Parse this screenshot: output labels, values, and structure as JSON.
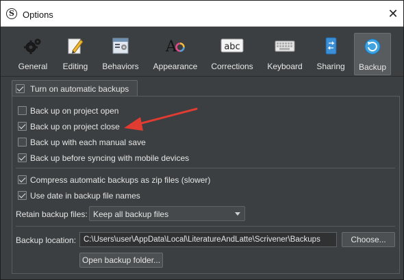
{
  "window": {
    "title": "Options"
  },
  "toolbar": {
    "items": [
      {
        "label": "General",
        "icon": "gears-icon"
      },
      {
        "label": "Editing",
        "icon": "pencil-icon"
      },
      {
        "label": "Behaviors",
        "icon": "behaviors-icon"
      },
      {
        "label": "Appearance",
        "icon": "font-color-icon"
      },
      {
        "label": "Corrections",
        "icon": "abc-icon"
      },
      {
        "label": "Keyboard",
        "icon": "keyboard-icon"
      },
      {
        "label": "Sharing",
        "icon": "sharing-icon"
      },
      {
        "label": "Backup",
        "icon": "backup-icon"
      }
    ],
    "active": "Backup"
  },
  "backup": {
    "master_toggle": {
      "label": "Turn on automatic backups",
      "checked": true
    },
    "options": [
      {
        "label": "Back up on project open",
        "checked": false
      },
      {
        "label": "Back up on project close",
        "checked": true
      },
      {
        "label": "Back up with each manual save",
        "checked": false
      },
      {
        "label": "Back up before syncing with mobile devices",
        "checked": true
      }
    ],
    "format_options": [
      {
        "label": "Compress automatic backups as zip files (slower)",
        "checked": true
      },
      {
        "label": "Use date in backup file names",
        "checked": true
      }
    ],
    "retain": {
      "label": "Retain backup files:",
      "value": "Keep all backup files"
    },
    "location": {
      "label": "Backup location:",
      "path": "C:\\Users\\user\\AppData\\Local\\LiteratureAndLatte\\Scrivener\\Backups",
      "choose_label": "Choose...",
      "open_label": "Open backup folder..."
    }
  },
  "annotation": {
    "color": "#e03c31"
  }
}
